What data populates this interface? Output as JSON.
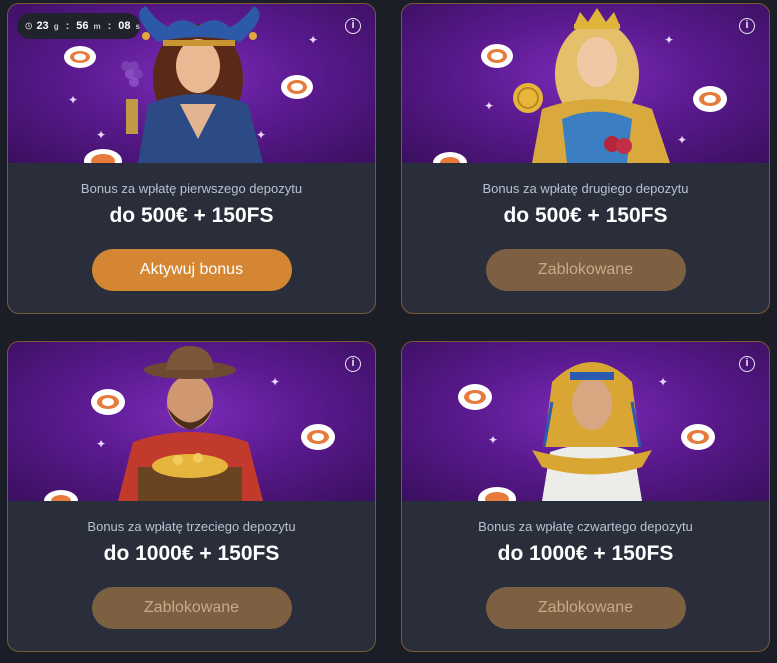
{
  "timer": {
    "days": "23",
    "days_unit": "g",
    "hours": "56",
    "hours_unit": "m",
    "minutes": "08",
    "minutes_unit": "s"
  },
  "cards": [
    {
      "label": "Bonus za wpłatę pierwszego depozytu",
      "amount": "do 500€ + 150FS",
      "button": "Aktywuj bonus",
      "status": "active",
      "character": "jester-woman-with-grapes"
    },
    {
      "label": "Bonus za wpłatę drugiego depozytu",
      "amount": "do 500€ + 150FS",
      "button": "Zablokowane",
      "status": "locked",
      "character": "queen-with-coin"
    },
    {
      "label": "Bonus za wpłatę trzeciego depozytu",
      "amount": "do 1000€ + 150FS",
      "button": "Zablokowane",
      "status": "locked",
      "character": "explorer-with-treasure"
    },
    {
      "label": "Bonus za wpłatę czwartego depozytu",
      "amount": "do 1000€ + 150FS",
      "button": "Zablokowane",
      "status": "locked",
      "character": "egyptian-queen"
    }
  ],
  "colors": {
    "page_bg": "#1b1e27",
    "card_bg": "#2a2e3b",
    "card_border": "#7a5a35",
    "button_active": "#d48633",
    "button_locked": "#7d5f42",
    "banner_purple": "#6a23a4"
  }
}
